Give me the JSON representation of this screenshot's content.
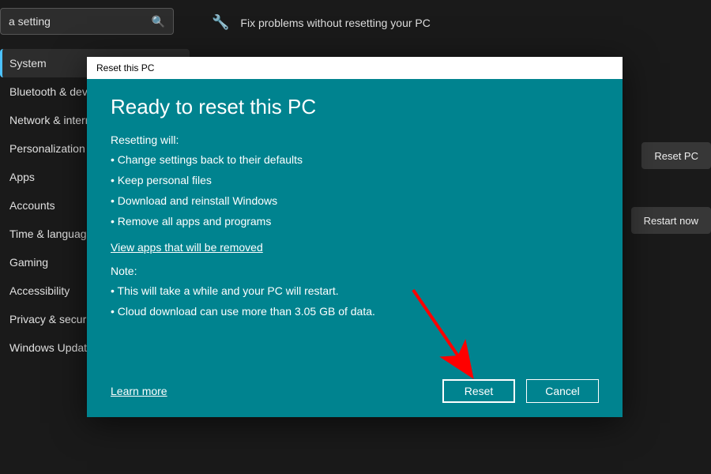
{
  "search": {
    "text": "a setting",
    "icon": "search"
  },
  "sidebar": {
    "items": [
      {
        "label": "System",
        "selected": true
      },
      {
        "label": "Bluetooth & devices"
      },
      {
        "label": "Network & internet"
      },
      {
        "label": "Personalization"
      },
      {
        "label": "Apps"
      },
      {
        "label": "Accounts"
      },
      {
        "label": "Time & language"
      },
      {
        "label": "Gaming"
      },
      {
        "label": "Accessibility"
      },
      {
        "label": "Privacy & security"
      },
      {
        "label": "Windows Update"
      }
    ]
  },
  "main": {
    "fix_row": "Fix problems without resetting your PC",
    "reset_pc_btn": "Reset PC",
    "restart_btn": "Restart now"
  },
  "dialog": {
    "titlebar": "Reset this PC",
    "heading": "Ready to reset this PC",
    "resetting_label": "Resetting will:",
    "bullets": [
      "Change settings back to their defaults",
      "Keep personal files",
      "Download and reinstall Windows",
      "Remove all apps and programs"
    ],
    "view_apps_link": "View apps that will be removed",
    "note_label": "Note:",
    "note_bullets": [
      "This will take a while and your PC will restart.",
      "Cloud download can use more than 3.05 GB of data."
    ],
    "learn_more": "Learn more",
    "reset_btn": "Reset",
    "cancel_btn": "Cancel"
  }
}
